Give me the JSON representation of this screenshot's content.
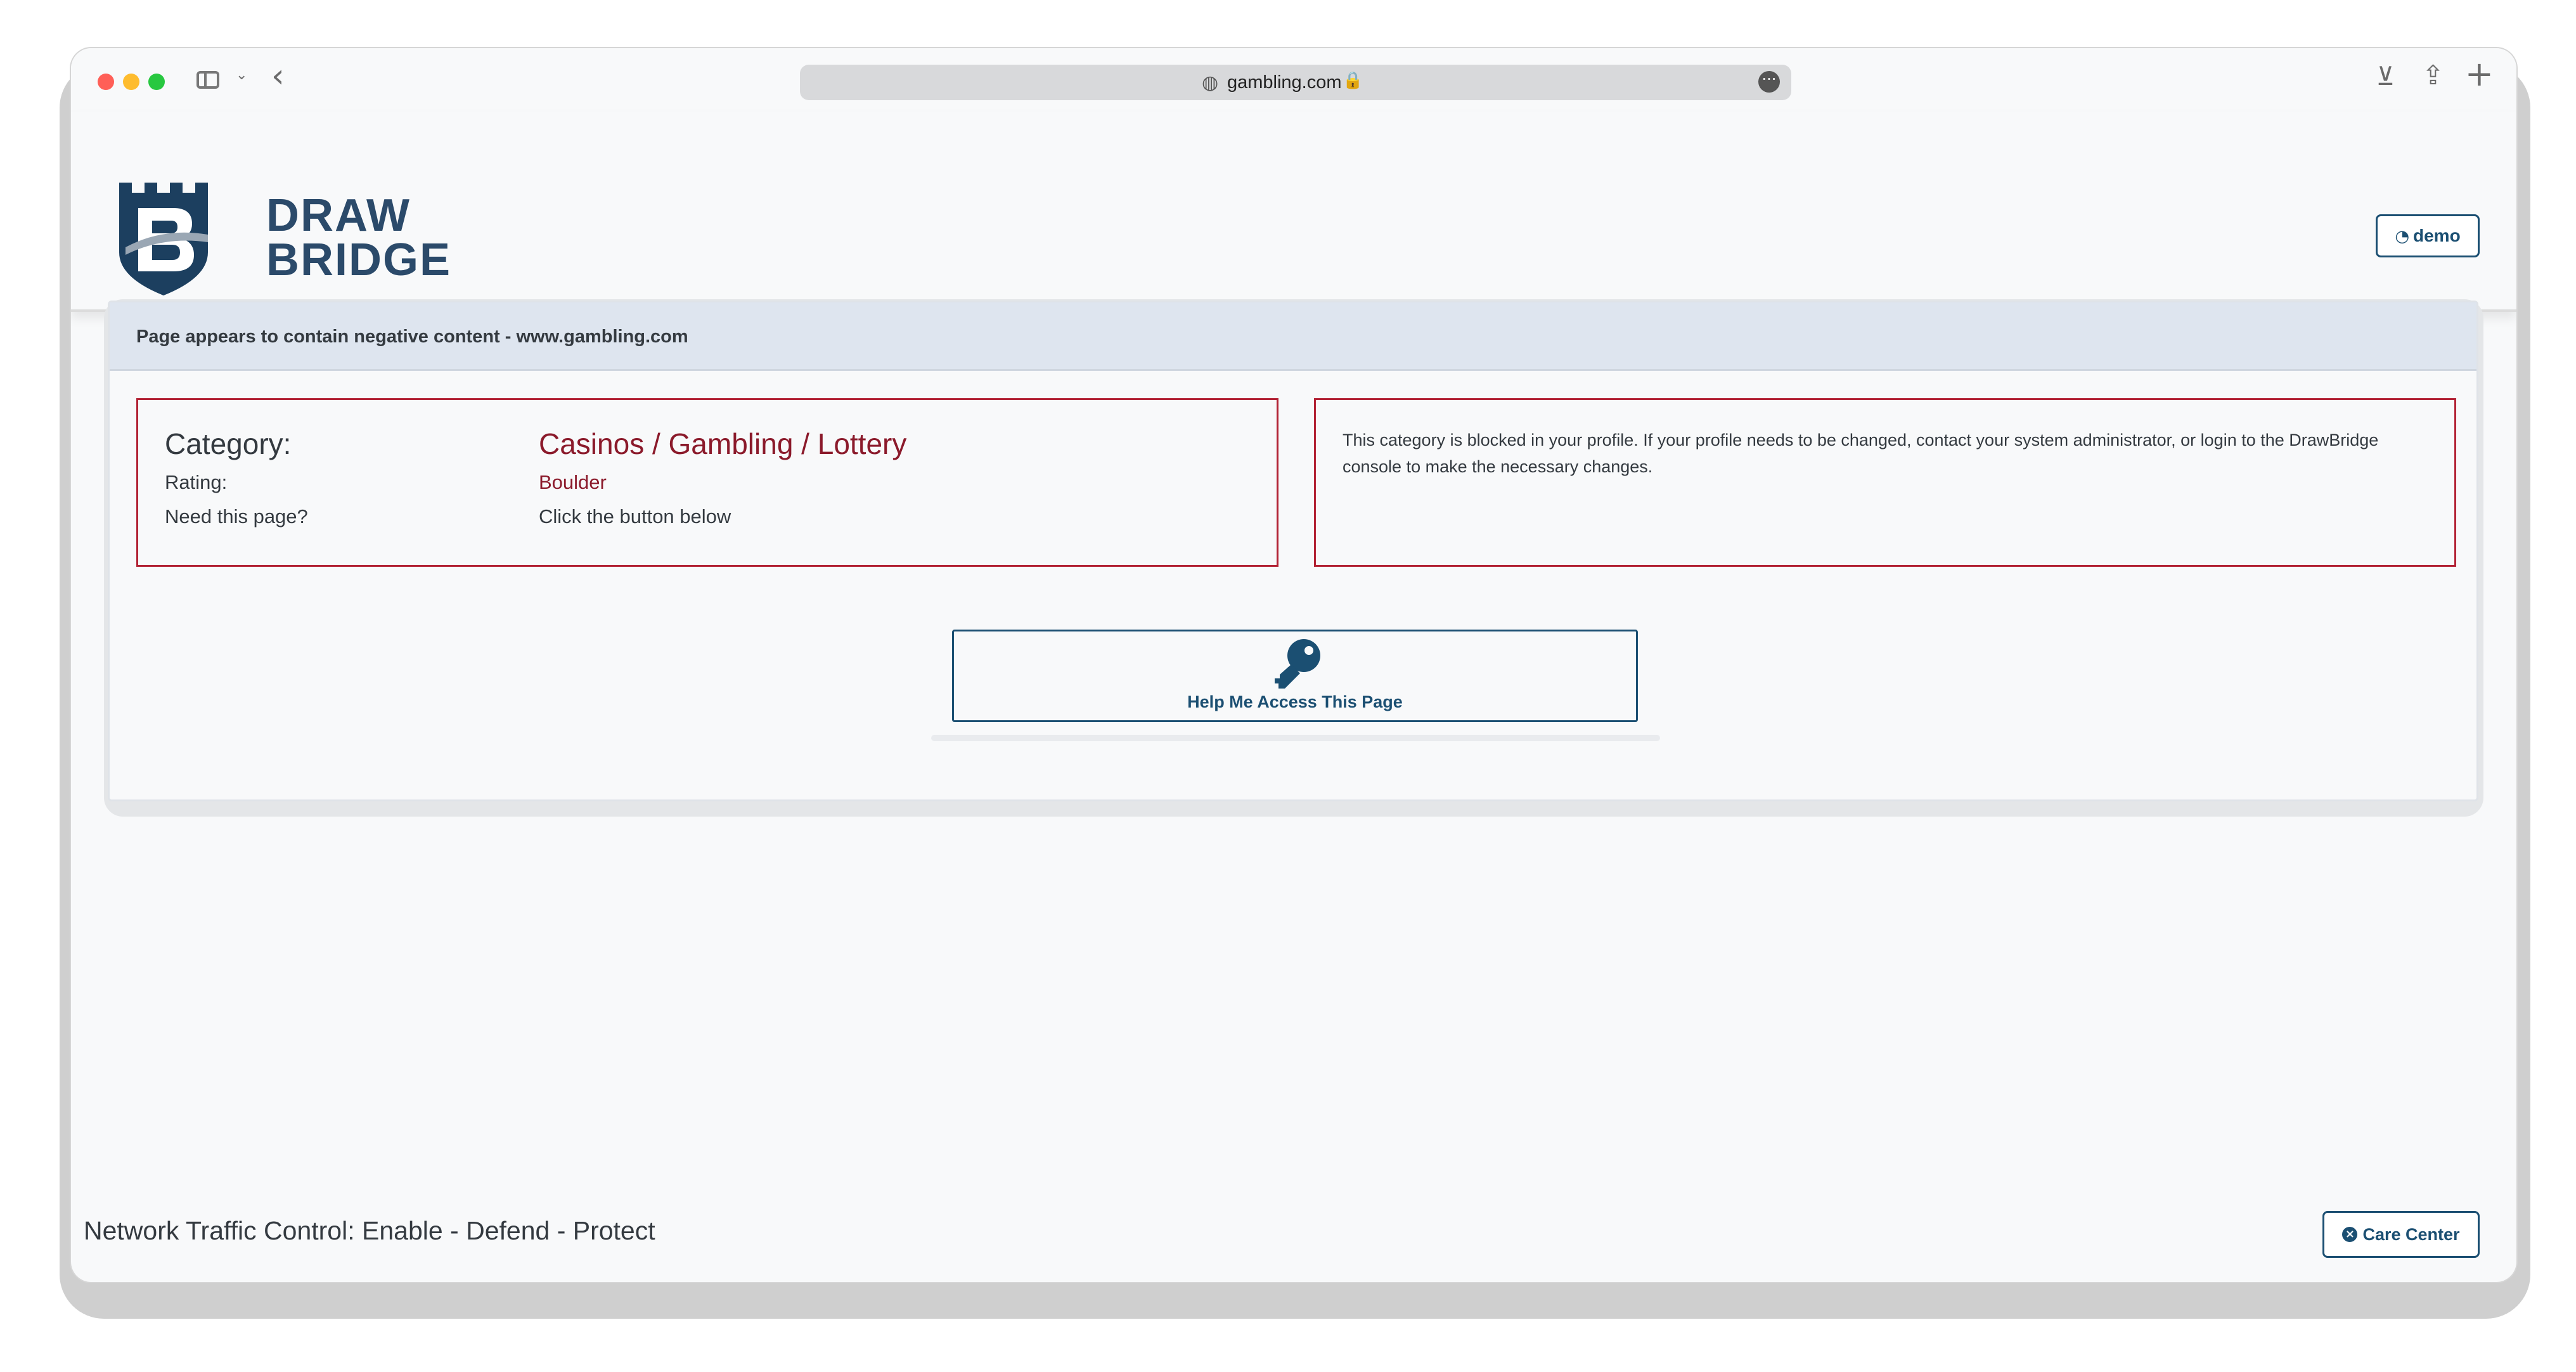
{
  "browser": {
    "url": "gambling.com"
  },
  "header": {
    "logo_line1": "DRAW",
    "logo_line2": "BRIDGE",
    "user_button": "demo"
  },
  "notice": {
    "title": "Page appears to contain negative content - www.gambling.com",
    "category_label": "Category:",
    "category_value": "Casinos / Gambling / Lottery",
    "rating_label": "Rating:",
    "rating_value": "Boulder",
    "need_label": "Need this page?",
    "need_value": "Click the button below",
    "message": "This category is blocked in your profile. If your profile needs to be changed, contact your system administrator, or login to the DrawBridge console to make the necessary changes.",
    "help_button": "Help Me Access This Page"
  },
  "footer": {
    "tagline": "Network Traffic Control: Enable - Defend - Protect",
    "care_button": "Care Center"
  },
  "colors": {
    "brand_navy": "#1b4f72",
    "alert_red": "#b22234",
    "header_band": "#dee5ef"
  },
  "icons": [
    "sidebar-icon",
    "chevron-down-icon",
    "back-icon",
    "globe-icon",
    "lock-icon",
    "more-icon",
    "download-icon",
    "share-icon",
    "plus-icon",
    "dashboard-icon",
    "key-icon",
    "close-circle-icon"
  ]
}
